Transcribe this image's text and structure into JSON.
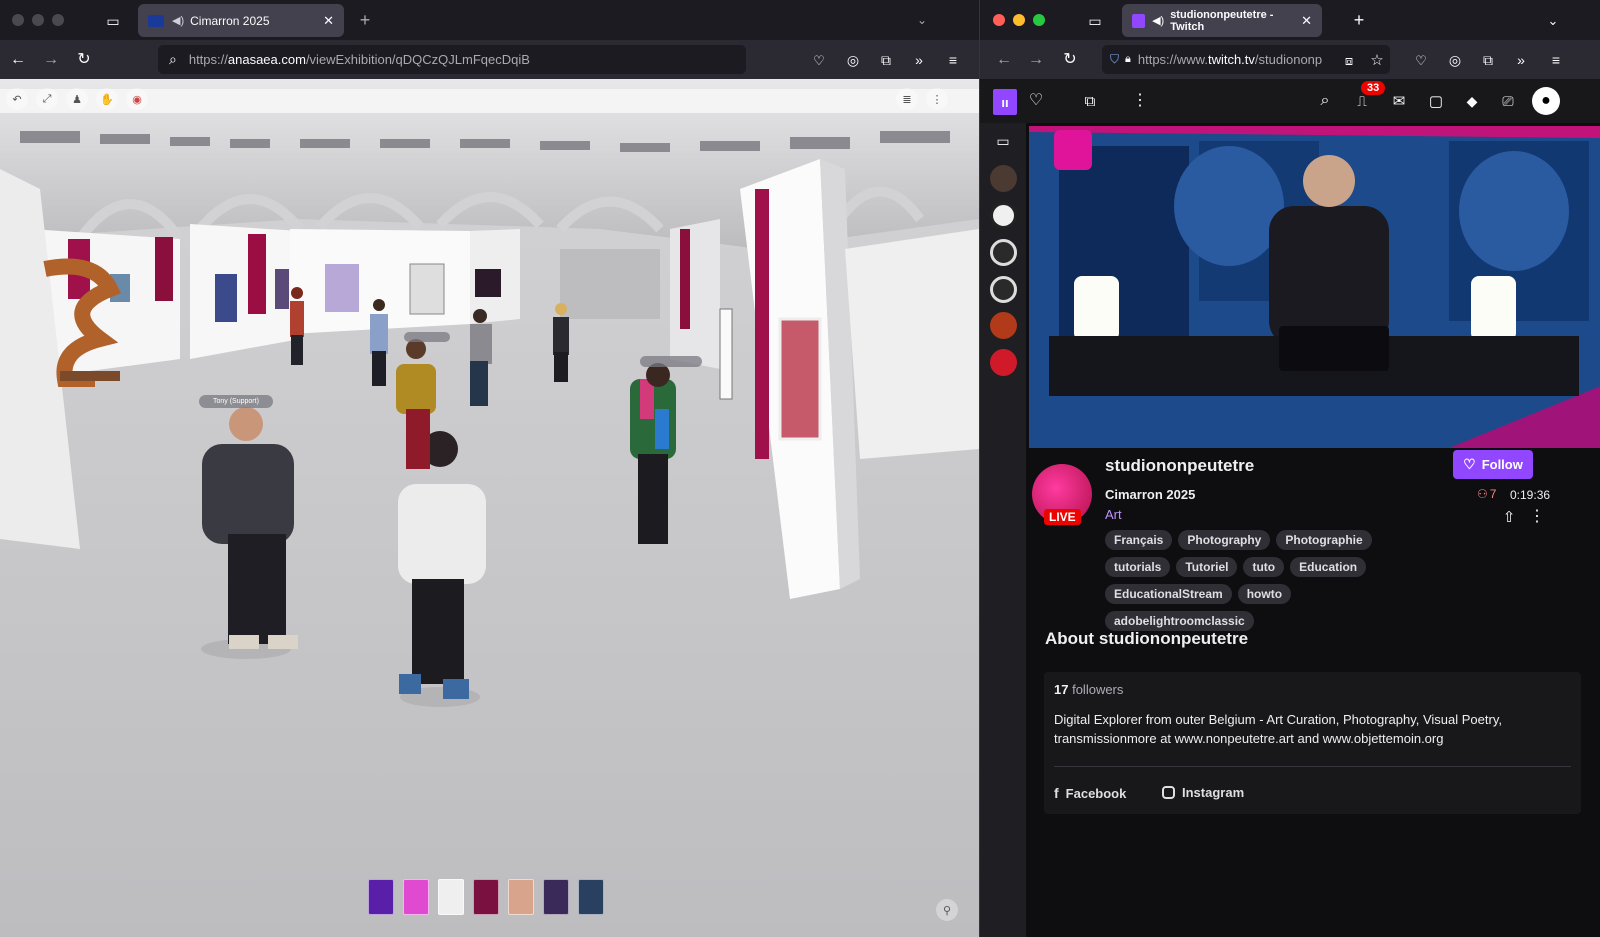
{
  "left_browser": {
    "tab_title": "Cimarron 2025",
    "url_prefix": "https://",
    "url_domain": "anasaea.com",
    "url_path": "/viewExhibition/qDQCzQJLmFqecDqiB",
    "scene": {
      "name_tags": [
        "Tony (Support)"
      ],
      "thumbnails": [
        "#5a1fa8",
        "#e04ad0",
        "#efefef",
        "#7a1040",
        "#d8a48c",
        "#3a2a5a",
        "#2a4060"
      ]
    }
  },
  "right_browser": {
    "tab_title": "studiononpeutetre - Twitch",
    "url_prefix": "https://www.",
    "url_domain": "twitch.tv",
    "url_path": "/studiononp",
    "notification_count": "33",
    "channel": {
      "name": "studiononpeutetre",
      "live_badge": "LIVE",
      "stream_title": "Cimarron 2025",
      "category": "Art",
      "follow_label": "Follow",
      "viewers": "7",
      "uptime": "0:19:36",
      "tags": [
        "Français",
        "Photography",
        "Photographie",
        "tutorials",
        "Tutoriel",
        "tuto",
        "Education",
        "EducationalStream",
        "howto",
        "adobelightroomclassic"
      ]
    },
    "about": {
      "heading": "About studiononpeutetre",
      "followers_count": "17",
      "followers_label": "followers",
      "bio": "Digital Explorer from outer Belgium - Art Curation, Photography, Visual Poetry, transmissionmore at www.nonpeutetre.art and www.objettemoin.org",
      "links": [
        {
          "label": "Facebook",
          "icon": "facebook-icon"
        },
        {
          "label": "Instagram",
          "icon": "instagram-icon"
        }
      ]
    },
    "accent_color": "#9147ff",
    "live_color": "#eb0400"
  }
}
